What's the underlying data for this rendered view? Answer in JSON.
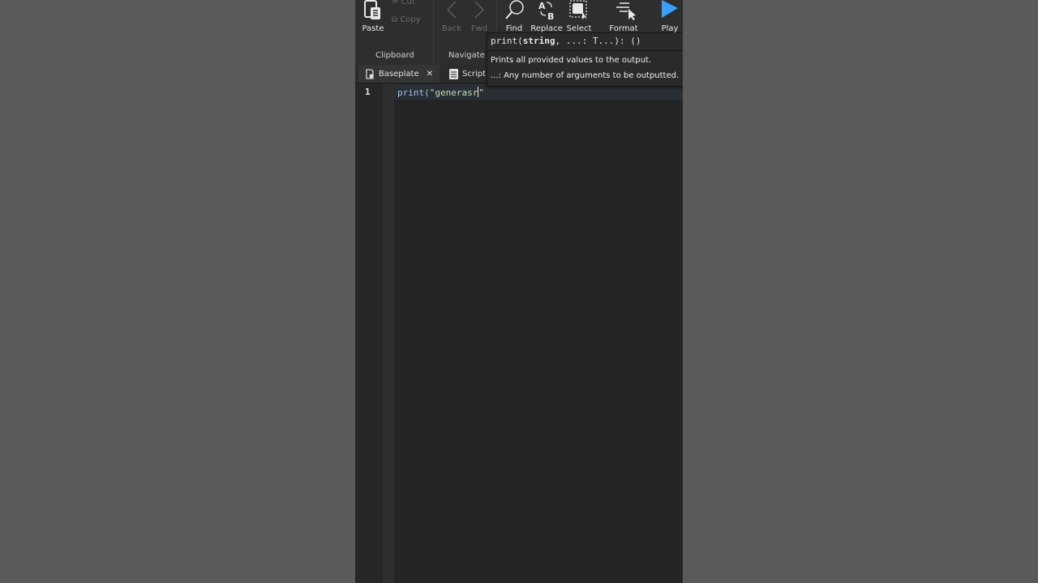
{
  "ribbon": {
    "clipboard": {
      "paste_label": "Paste",
      "cut_label": "Cut",
      "copy_label": "Copy",
      "group_label": "Clipboard"
    },
    "navigate": {
      "back_label": "Back",
      "fwd_label": "Fwd",
      "group_label": "Navigate"
    },
    "edit": {
      "find_label": "Find",
      "replace_label": "Replace",
      "select_label": "Select",
      "format_label": "Format"
    },
    "play_label": "Play",
    "accent_color": "#3aa0ff"
  },
  "tabs": [
    {
      "label": "Baseplate",
      "icon": "place-icon",
      "closable": true
    },
    {
      "label": "Script",
      "icon": "script-icon",
      "closable": false
    }
  ],
  "editor": {
    "line_number": "1",
    "code_fn": "print(",
    "code_string_open": "\"generasr",
    "code_string_close": "\""
  },
  "tooltip": {
    "sig_prefix": "print(",
    "sig_param": "string",
    "sig_suffix": ", ...: T...): ()",
    "description": "Prints all provided values to the output.",
    "param_doc": "...: Any number of arguments to be outputted."
  }
}
